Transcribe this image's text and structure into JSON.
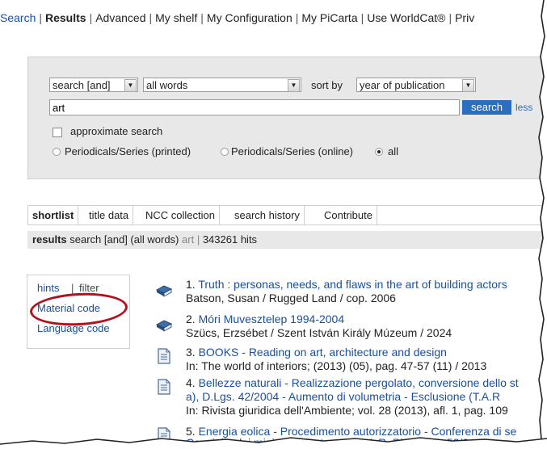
{
  "topnav": [
    {
      "label": "Search",
      "active": false
    },
    {
      "label": "Results",
      "active": true
    },
    {
      "label": "Advanced",
      "active": false
    },
    {
      "label": "My shelf",
      "active": false
    },
    {
      "label": "My Configuration",
      "active": false
    },
    {
      "label": "My PiCarta",
      "active": false
    },
    {
      "label": "Use WorldCat®",
      "active": false
    },
    {
      "label": "Priv",
      "active": false
    }
  ],
  "search": {
    "operator": "search [and]",
    "scope": "all words",
    "sort_label": "sort by",
    "sort_value": "year of publication",
    "query": "art",
    "button": "search",
    "less": "less",
    "approx": "approximate search",
    "radios": [
      {
        "label": "Periodicals/Series (printed)",
        "checked": false
      },
      {
        "label": "Periodicals/Series (online)",
        "checked": false
      },
      {
        "label": "all",
        "checked": true
      }
    ]
  },
  "tabs": [
    "shortlist",
    "title data",
    "NCC collection",
    "search history",
    "Contribute"
  ],
  "results_bar": {
    "label": "results",
    "query": "search [and] (all words)",
    "term": "art",
    "sep": "|",
    "hits": "343261 hits"
  },
  "sidebar": {
    "hints": "hints",
    "sep": "|",
    "filter": "filter",
    "material": "Material code",
    "language": "Language code"
  },
  "results": [
    {
      "num": "1.",
      "title": "Truth : personas, needs, and flaws in the art of building actors",
      "sub": "Batson, Susan / Rugged Land / cop. 2006",
      "icon": "book-icon"
    },
    {
      "num": "2.",
      "title": "Móri Muvesztelep 1994-2004",
      "sub": "Szücs, Erzsébet / Szent István Király Múzeum / 2024",
      "icon": "book-icon"
    },
    {
      "num": "3.",
      "title": "BOOKS - Reading on art, architecture and design",
      "sub": "In: The world of interiors; (2013) (05), pag. 47-57 (11) / 2013",
      "icon": "article-icon"
    },
    {
      "num": "4.",
      "title": "Bellezze naturali - Realizzazione pergolato, conversione dello st",
      "title2": "a), D.Lgs. 42/2004 - Aumento di volumetria - Esclusione (T.A.R",
      "sub": "In: Rivista giuridica dell'Ambiente; vol. 28 (2013), afl. 1, pag. 109",
      "icon": "article-icon"
    },
    {
      "num": "5.",
      "title": "Energia eolica - Procedimento autorizzatorio - Conferenza di se",
      "sub": "Consiglio dei ministri - Contenuto (T.A.R. Piemonte, 52/2",
      "icon": "article-icon"
    }
  ]
}
